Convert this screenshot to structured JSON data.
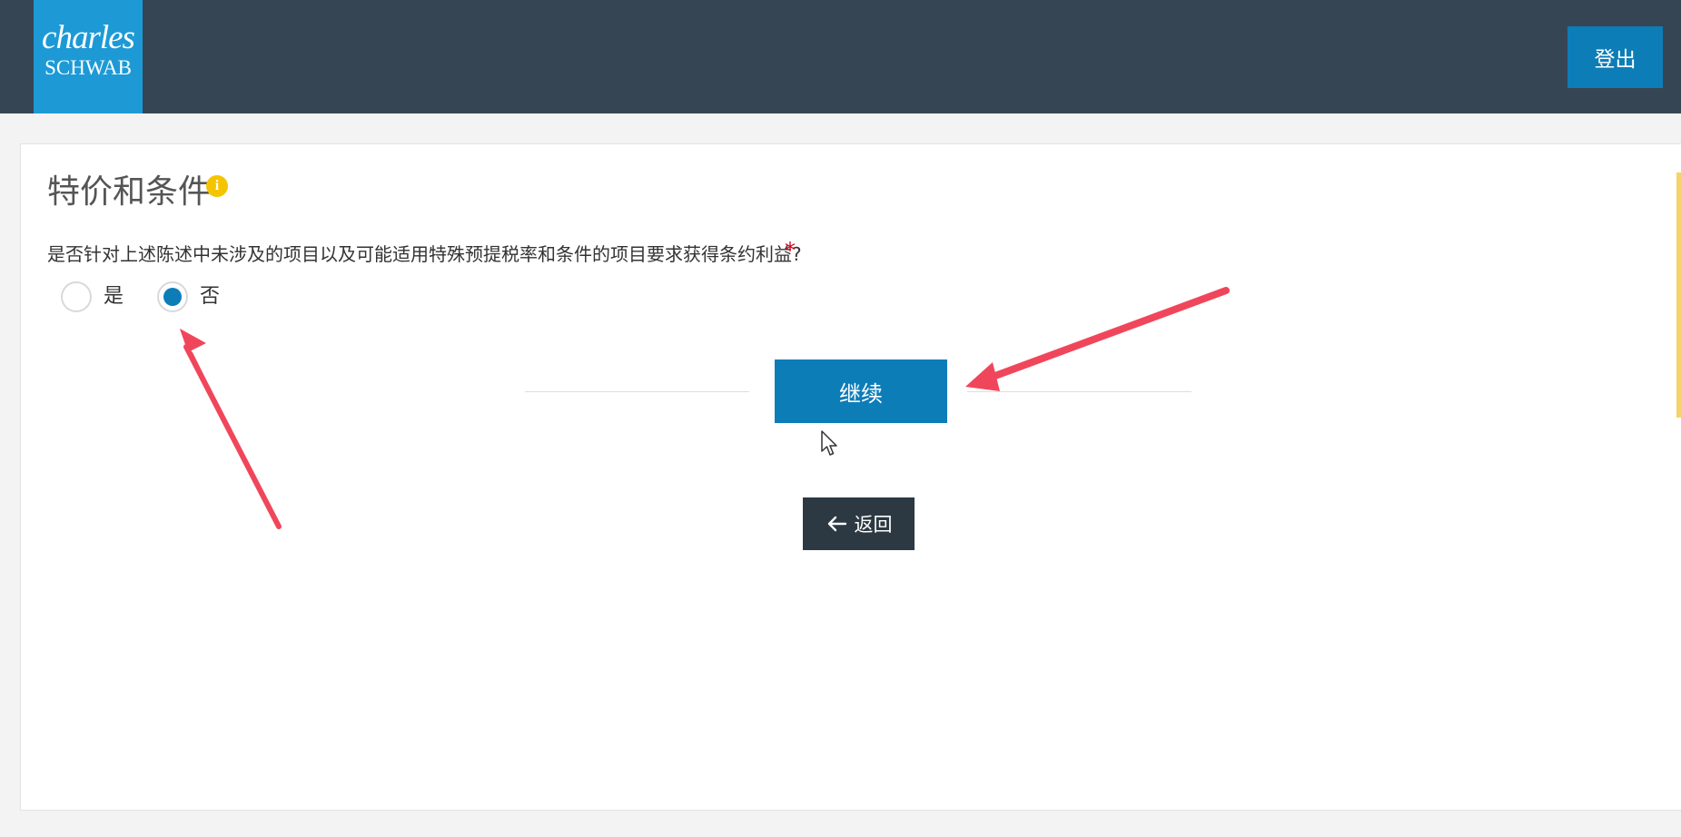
{
  "header": {
    "logo": {
      "line1": "charles",
      "line2": "SCHWAB"
    },
    "logout_label": "登出"
  },
  "section": {
    "title": "特价和条件",
    "info_icon_glyph": "i"
  },
  "question": {
    "text": "是否针对上述陈述中未涉及的项目以及可能适用特殊预提税率和条件的项目要求获得条约利益?",
    "required_mark": "*",
    "options": [
      {
        "label": "是",
        "selected": false
      },
      {
        "label": "否",
        "selected": true
      }
    ]
  },
  "actions": {
    "continue_label": "继续",
    "back_label": "返回"
  },
  "colors": {
    "header_bg": "#354553",
    "logo_bg": "#1d9ad6",
    "primary": "#0d7db8",
    "back_button_bg": "#2c3943",
    "annotation_arrow": "#f0465b",
    "info_icon": "#f5c400"
  },
  "icons": {
    "info": "info-icon",
    "back_arrow": "arrow-left-icon",
    "cursor": "mouse-pointer-icon"
  }
}
